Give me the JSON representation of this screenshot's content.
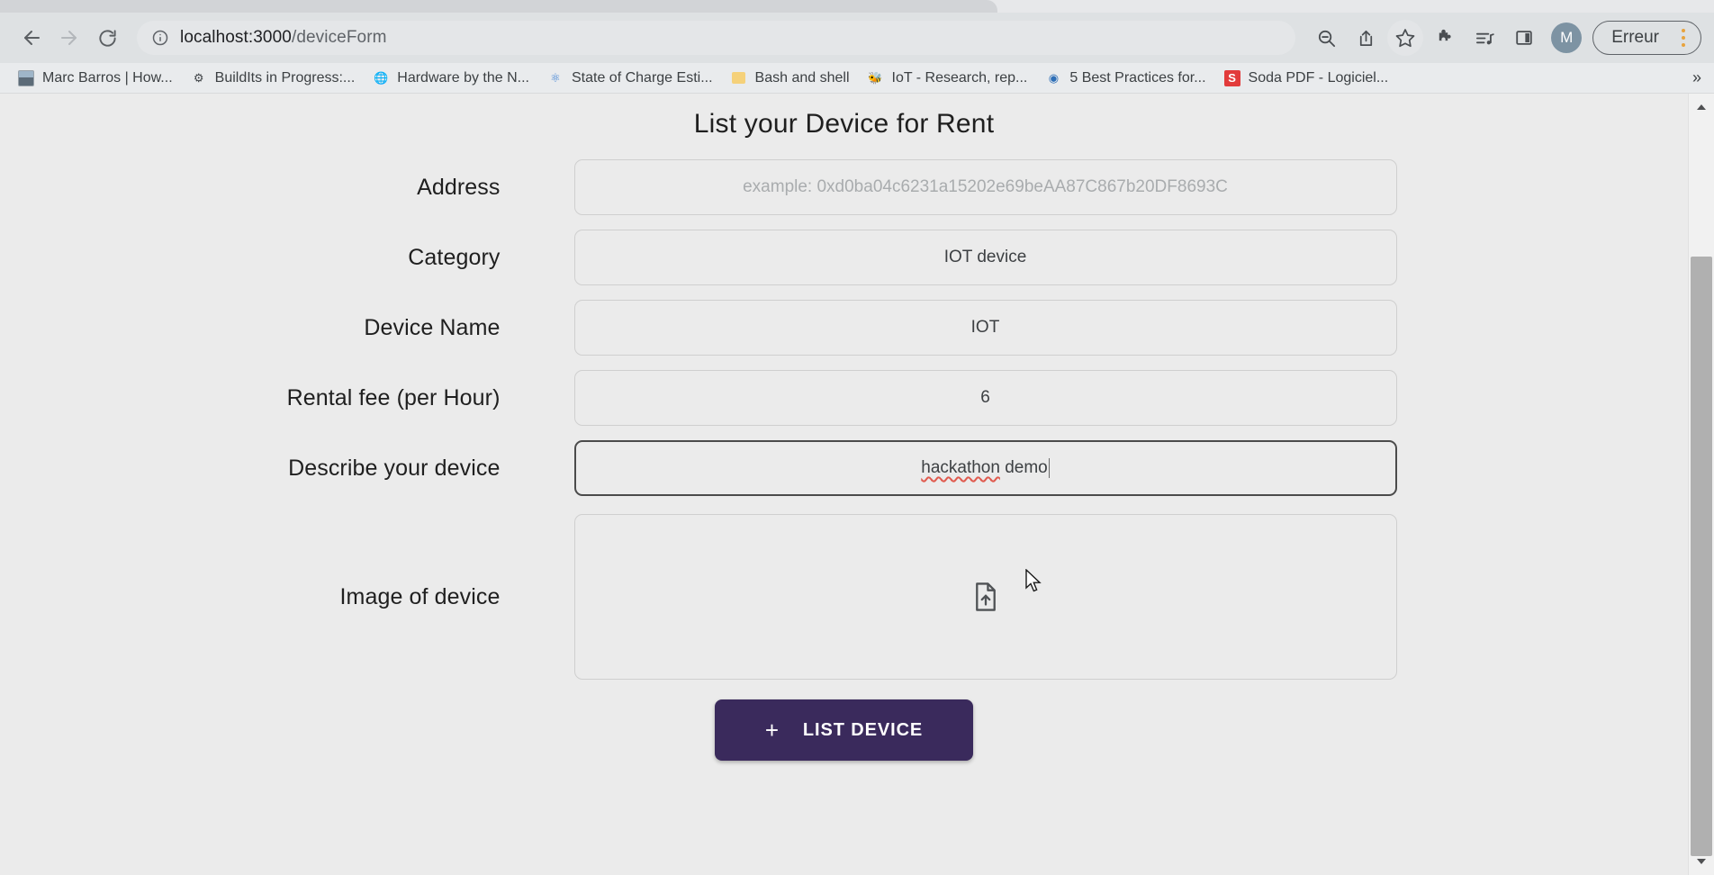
{
  "browser": {
    "nav": {
      "back_label": "Back",
      "forward_label": "Forward",
      "reload_label": "Reload"
    },
    "omnibox": {
      "site_info_icon": "info-circle-icon",
      "url_host": "localhost:3000",
      "url_path": "/deviceForm",
      "url_full": "localhost:3000/deviceForm"
    },
    "toolbar_icons": [
      {
        "name": "zoom-out-icon",
        "glyph": "search-minus"
      },
      {
        "name": "share-icon",
        "glyph": "share"
      },
      {
        "name": "bookmark-star-icon",
        "glyph": "star"
      },
      {
        "name": "extensions-puzzle-icon",
        "glyph": "puzzle"
      },
      {
        "name": "media-playlist-icon",
        "glyph": "playlist"
      },
      {
        "name": "side-panel-icon",
        "glyph": "panel"
      }
    ],
    "avatar": {
      "initial": "M"
    },
    "error_pill": {
      "label": "Erreur",
      "menu_icon": "kebab-menu-icon",
      "menu_color": "#e8a33d"
    },
    "bookmarks": {
      "overflow_label": "»",
      "items": [
        {
          "label": "Marc Barros | How...",
          "icon": "photo-favicon"
        },
        {
          "label": "BuildIts in Progress:...",
          "icon": "gears-favicon"
        },
        {
          "label": "Hardware by the N...",
          "icon": "globe-favicon"
        },
        {
          "label": "State of Charge Esti...",
          "icon": "atom-favicon"
        },
        {
          "label": "Bash and shell",
          "icon": "folder-favicon"
        },
        {
          "label": "IoT - Research, rep...",
          "icon": "bee-favicon"
        },
        {
          "label": "5 Best Practices for...",
          "icon": "blue-globe-favicon"
        },
        {
          "label": "Soda PDF - Logiciel...",
          "icon": "soda-pdf-favicon"
        }
      ]
    }
  },
  "page": {
    "title": "List your Device for Rent",
    "fields": [
      {
        "id": "address",
        "label": "Address",
        "value": "",
        "placeholder": "example: 0xd0ba04c6231a15202e69beAA87C867b20DF8693C",
        "state": "empty"
      },
      {
        "id": "category",
        "label": "Category",
        "value": "IOT device",
        "placeholder": "",
        "state": "filled"
      },
      {
        "id": "device-name",
        "label": "Device Name",
        "value": "IOT",
        "placeholder": "",
        "state": "filled"
      },
      {
        "id": "rental-fee",
        "label": "Rental fee (per Hour)",
        "value": "6",
        "placeholder": "",
        "state": "filled"
      },
      {
        "id": "description",
        "label": "Describe your device",
        "value": "hackathon demo",
        "value_misspelled": "hackathon",
        "value_rest": " demo",
        "placeholder": "",
        "state": "focused"
      }
    ],
    "upload": {
      "label": "Image of device",
      "icon": "file-upload-icon"
    },
    "submit": {
      "plus": "+",
      "label": "LIST DEVICE",
      "color": "#3a2a5c"
    },
    "colors": {
      "background": "#ebebeb",
      "field_border": "#cfcfcf",
      "focus_border": "#4b4b4b",
      "accent": "#3a2a5c",
      "spellcheck": "#e05a4e"
    }
  },
  "scrollbar": {
    "up_icon": "scroll-up-arrow-icon",
    "down_icon": "scroll-down-arrow-icon",
    "thumb": "scroll-thumb"
  }
}
